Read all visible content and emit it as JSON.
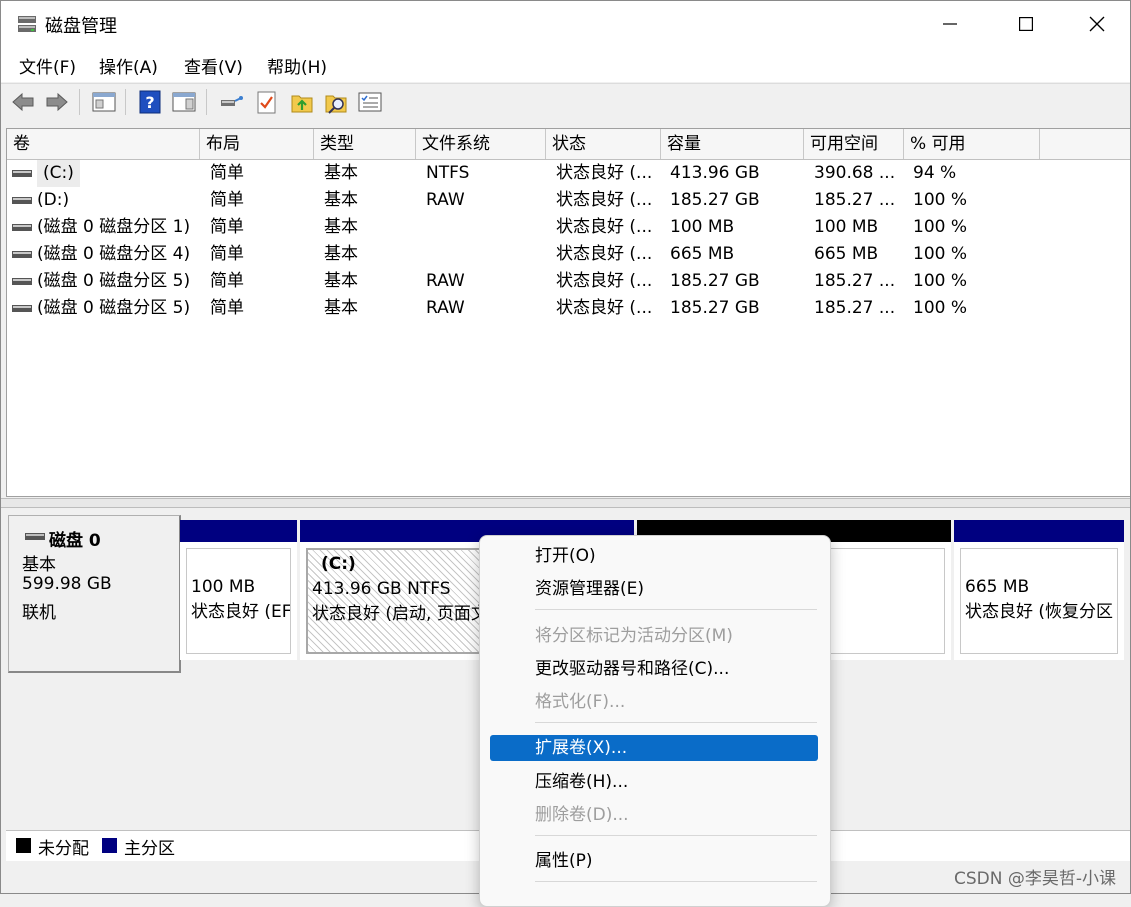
{
  "window": {
    "title": "磁盘管理"
  },
  "menubar": [
    {
      "label": "文件(F)"
    },
    {
      "label": "操作(A)"
    },
    {
      "label": "查看(V)"
    },
    {
      "label": "帮助(H)"
    }
  ],
  "toolbar": {
    "icons": [
      "back-arrow-icon",
      "forward-arrow-icon",
      "console-tree-icon",
      "help-icon",
      "action-pane-icon",
      "connect-icon",
      "checklist-icon",
      "folder-up-icon",
      "search-folder-icon",
      "properties-list-icon"
    ]
  },
  "list": {
    "columns": [
      "卷",
      "布局",
      "类型",
      "文件系统",
      "状态",
      "容量",
      "可用空间",
      "% 可用"
    ],
    "rows": [
      {
        "volume": "(C:)",
        "layout": "简单",
        "type": "基本",
        "fs": "NTFS",
        "status": "状态良好 (...",
        "capacity": "413.96 GB",
        "free": "390.68 ...",
        "pct": "94 %"
      },
      {
        "volume": "(D:)",
        "layout": "简单",
        "type": "基本",
        "fs": "RAW",
        "status": "状态良好 (...",
        "capacity": "185.27 GB",
        "free": "185.27 ...",
        "pct": "100 %"
      },
      {
        "volume": "(磁盘 0 磁盘分区 1)",
        "layout": "简单",
        "type": "基本",
        "fs": "",
        "status": "状态良好 (...",
        "capacity": "100 MB",
        "free": "100 MB",
        "pct": "100 %"
      },
      {
        "volume": "(磁盘 0 磁盘分区 4)",
        "layout": "简单",
        "type": "基本",
        "fs": "",
        "status": "状态良好 (...",
        "capacity": "665 MB",
        "free": "665 MB",
        "pct": "100 %"
      },
      {
        "volume": "(磁盘 0 磁盘分区 5)",
        "layout": "简单",
        "type": "基本",
        "fs": "RAW",
        "status": "状态良好 (...",
        "capacity": "185.27 GB",
        "free": "185.27 ...",
        "pct": "100 %"
      },
      {
        "volume": "(磁盘 0 磁盘分区 5)",
        "layout": "简单",
        "type": "基本",
        "fs": "RAW",
        "status": "状态良好 (...",
        "capacity": "185.27 GB",
        "free": "185.27 ...",
        "pct": "100 %"
      }
    ]
  },
  "disk": {
    "name": "磁盘 0",
    "type": "基本",
    "size": "599.98 GB",
    "state": "联机",
    "partitions": [
      {
        "title": "",
        "size": "100 MB",
        "status": "状态良好 (EF"
      },
      {
        "title": "(C:)",
        "size": "413.96 GB NTFS",
        "status": "状态良好 (启动, 页面文"
      },
      {
        "title": "",
        "size": "",
        "status": ""
      },
      {
        "title": "",
        "size": "665 MB",
        "status": "状态良好 (恢复分区"
      }
    ]
  },
  "legend": [
    {
      "label": "未分配",
      "color": "#000000"
    },
    {
      "label": "主分区",
      "color": "#000080"
    }
  ],
  "context_menu": {
    "items": [
      {
        "label": "打开(O)",
        "disabled": false
      },
      {
        "label": "资源管理器(E)",
        "disabled": false
      },
      {
        "label": "将分区标记为活动分区(M)",
        "disabled": true
      },
      {
        "label": "更改驱动器号和路径(C)...",
        "disabled": false
      },
      {
        "label": "格式化(F)...",
        "disabled": true
      },
      {
        "label": "扩展卷(X)...",
        "disabled": false,
        "selected": true
      },
      {
        "label": "压缩卷(H)...",
        "disabled": false
      },
      {
        "label": "删除卷(D)...",
        "disabled": true
      },
      {
        "label": "属性(P)",
        "disabled": false
      }
    ]
  },
  "watermark": "CSDN @李昊哲-小课",
  "colors": {
    "primary_partition": "#000080",
    "unallocated": "#000000",
    "selection": "#0a6cc8"
  }
}
